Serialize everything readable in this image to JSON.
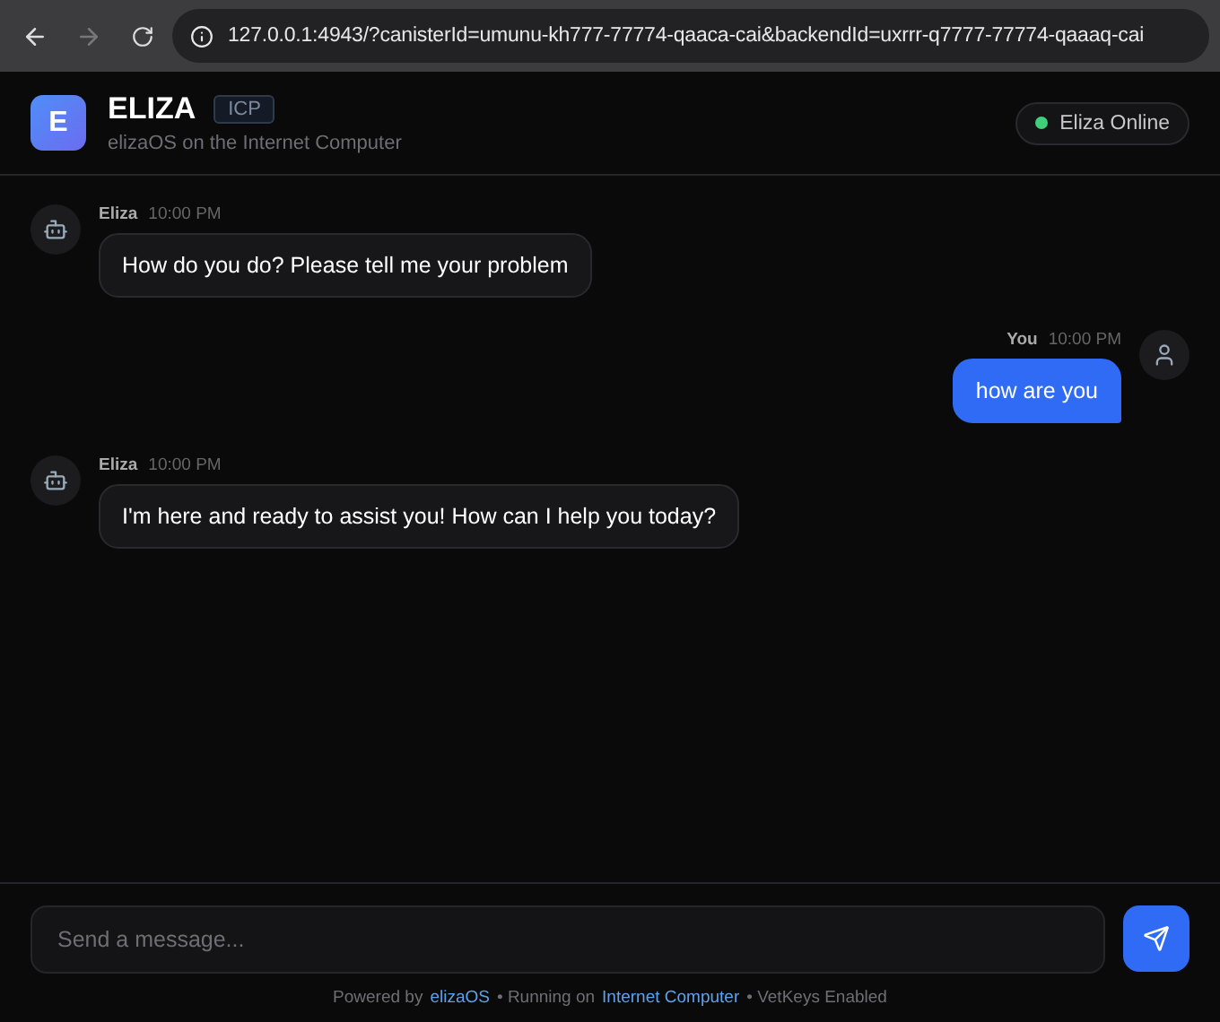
{
  "browser": {
    "url": "127.0.0.1:4943/?canisterId=umunu-kh777-77774-qaaca-cai&backendId=uxrrr-q7777-77774-qaaaq-cai"
  },
  "header": {
    "logo_letter": "E",
    "title": "ELIZA",
    "badge": "ICP",
    "subtitle": "elizaOS on the Internet Computer",
    "status": {
      "label": "Eliza Online",
      "online": true
    }
  },
  "messages": [
    {
      "kind": "bot",
      "sender": "Eliza",
      "time": "10:00 PM",
      "text": "How do you do? Please tell me your problem"
    },
    {
      "kind": "user",
      "sender": "You",
      "time": "10:00 PM",
      "text": "how are you"
    },
    {
      "kind": "bot",
      "sender": "Eliza",
      "time": "10:00 PM",
      "text": "I'm here and ready to assist you! How can I help you today?"
    }
  ],
  "composer": {
    "placeholder": "Send a message..."
  },
  "footer": [
    {
      "kind": "text",
      "text": "Powered by"
    },
    {
      "kind": "link",
      "text": "elizaOS"
    },
    {
      "kind": "text",
      "text": "• Running on"
    },
    {
      "kind": "link",
      "text": "Internet Computer"
    },
    {
      "kind": "text",
      "text": "• VetKeys Enabled"
    }
  ]
}
